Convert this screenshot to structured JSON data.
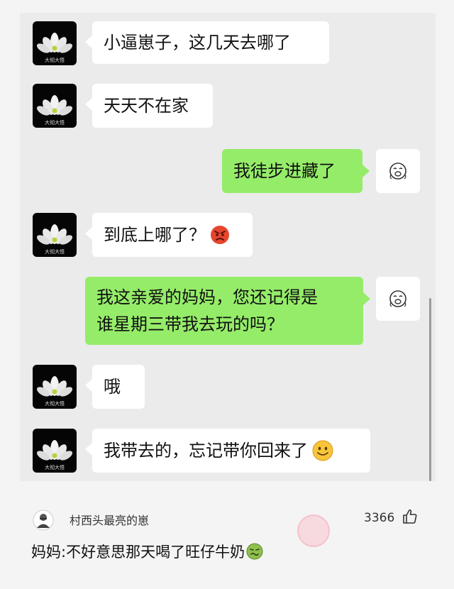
{
  "messages": [
    {
      "side": "left",
      "text": "小逼崽子，这几天去哪了"
    },
    {
      "side": "left",
      "text": "天天不在家"
    },
    {
      "side": "right",
      "text": "我徒步进藏了"
    },
    {
      "side": "left",
      "text": "到底上哪了？",
      "emoji": "angry-emoji"
    },
    {
      "side": "right",
      "lines": [
        "我这亲爱的妈妈，您还记得是",
        "谁星期三带我去玩的吗？"
      ]
    },
    {
      "side": "left",
      "text": "哦"
    },
    {
      "side": "left",
      "text": "我带去的，忘记带你回来了",
      "emoji": "smile-emoji"
    }
  ],
  "avatar_caption": "大彻大悟",
  "comment": {
    "username": "村西头最亮的崽",
    "likes": "3366",
    "text": "妈妈:不好意思那天喝了旺仔牛奶",
    "emoji": "sick-emoji"
  },
  "colors": {
    "chat_bg": "#ebebeb",
    "bubble_left": "#ffffff",
    "bubble_right": "#95ec69"
  }
}
